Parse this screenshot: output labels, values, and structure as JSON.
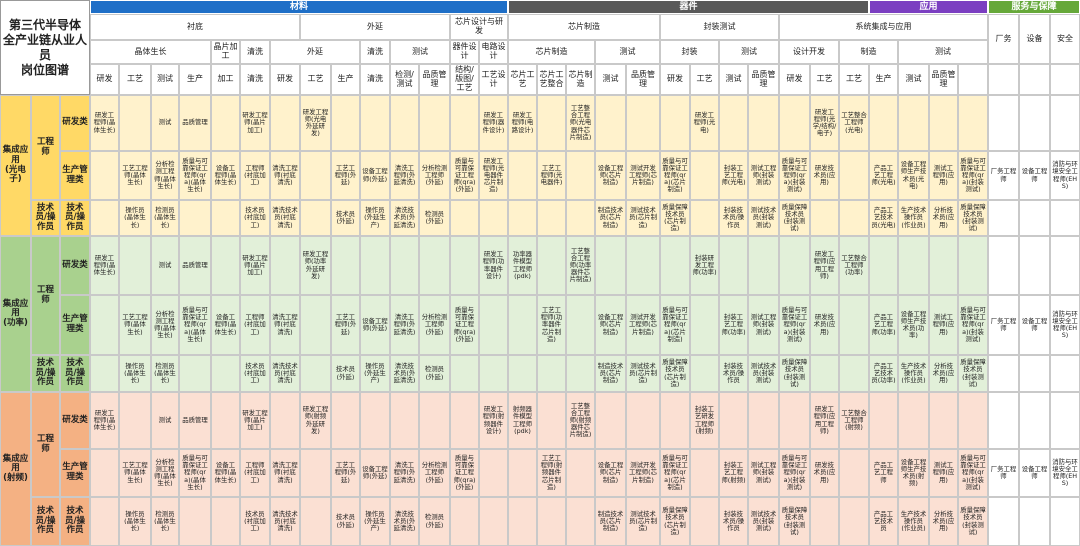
{
  "title": "第三代半导体\n全产业链从业人员\n岗位图谱",
  "colors": {
    "materials": "#1f6fc7",
    "devices": "#595959",
    "application": "#7b3fc1",
    "service": "#66a83a",
    "zone_opto": "#fff2cc",
    "zone_power": "#e2f0d9",
    "zone_rf": "#fbe0d3",
    "label_opto": "#ffd966",
    "label_power": "#a9d18e",
    "label_rf": "#f4b183"
  },
  "header": {
    "l1": [
      "材料",
      "器件",
      "应用",
      "服务与保障"
    ],
    "l2": [
      "衬底",
      "外延",
      "芯片设计与研发",
      "芯片制造",
      "封装测试",
      "系统集成与应用"
    ],
    "l3": [
      "晶体生长",
      "晶片加工",
      "清洗",
      "外延",
      "清洗",
      "测试",
      "器件设计",
      "电路设计",
      "芯片制造",
      "测试",
      "封装",
      "测试",
      "设计开发",
      "制造",
      "测试"
    ],
    "l4": [
      "研发",
      "工艺",
      "测试",
      "生产",
      "加工",
      "清洗",
      "研发",
      "工艺",
      "生产",
      "清洗",
      "检测/测试",
      "品质管理",
      "结构/版图/工艺",
      "工艺设计",
      "芯片工艺",
      "芯片工艺整合",
      "芯片制造",
      "测试",
      "品质管理",
      "研发",
      "工艺",
      "测试",
      "品质管理",
      "研发",
      "工艺",
      "工艺",
      "生产",
      "测试",
      "品质管理"
    ],
    "service": [
      "厂务",
      "设备",
      "安全"
    ]
  },
  "zones": [
    {
      "name": "集成应用\n(光电子)",
      "engineer": "工程师",
      "tech": "技术员/操作员",
      "rows": [
        {
          "label": "研发类",
          "cells": [
            "研发工程师(晶体生长)",
            "",
            "测试",
            "品质管理",
            "",
            "研发工程师(晶片加工)",
            "",
            "研发工程师(光电外延研发)",
            "",
            "",
            "",
            "",
            "",
            "研发工程师(器件设计)",
            "研发工程师(电路设计)",
            "",
            "工艺整合工程师(光电器件芯片制造)",
            "",
            "",
            "",
            "研发工程师(光电)",
            "",
            "",
            "",
            "研发工程师(光学/结构/电子)",
            "工艺整合工程师(光电)",
            "",
            "",
            "",
            "",
            "",
            "",
            ""
          ]
        },
        {
          "label": "生产管理类",
          "cells": [
            "",
            "工艺工程师(晶体生长)",
            "分析检测工程师(晶体生长)",
            "质量与可靠保证工程师(qra)(晶体生长)",
            "设备工程师(晶体生长)",
            "工程师(衬底加工)",
            "清洗工程师(衬底清洗)",
            "",
            "工艺工程师(外延)",
            "设备工程师(外延)",
            "清洗工程师(外延清洗)",
            "分析检测工程师(外延)",
            "质量与可靠保证工程师(qra)(外延)",
            "研发工程师(光电器件芯片制造)",
            "",
            "工艺工程师(光电器件)",
            "",
            "设备工程师(芯片制造)",
            "测试开发工程师(芯片制造)",
            "质量与可靠保证工程师(qra)(芯片制造)",
            "",
            "封装工艺工程师(光电)",
            "测试工程师(封装测试)",
            "质量与可靠保证工程师(qra)(封装测试)",
            "研发技术员(应用)",
            "",
            "产品工艺工程师(光电)",
            "设备工程师生产技术员(光电)",
            "测试工程师(应用)",
            "质量与可靠保证工程师(qra)(封装测试)",
            "厂务工程师",
            "设备工程师",
            "消防与环境安全工程师(EHS)"
          ]
        },
        {
          "label": "技术员/操作员",
          "cells": [
            "",
            "操作员(晶体生长)",
            "检测员(晶体生长)",
            "",
            "",
            "技术员(衬底加工)",
            "清洗技术员(衬底清洗)",
            "",
            "技术员(外延)",
            "操作员(外延生产)",
            "清洗技术员(外延清洗)",
            "检测员(外延)",
            "",
            "",
            "",
            "",
            "",
            "制造技术员(芯片制造)",
            "测试技术员(芯片制造)",
            "质量保障技术员(芯片制造)",
            "",
            "封装技术员/操作员",
            "测试技术员(封装测试)",
            "质量保障技术员(封装测试)",
            "",
            "",
            "产品工艺技术员(光电)",
            "生产技术操作员(作业员)",
            "分析技术员(应用)",
            "质量保障技术员(封装测试)",
            "",
            "",
            ""
          ]
        }
      ]
    },
    {
      "name": "集成应用\n(功率)",
      "engineer": "工程师",
      "tech": "技术员/操作员",
      "rows": [
        {
          "label": "研发类",
          "cells": [
            "研发工程师(晶体生长)",
            "",
            "测试",
            "品质管理",
            "",
            "研发工程师(晶片加工)",
            "",
            "研发工程师(功率外延研发)",
            "",
            "",
            "",
            "",
            "",
            "研发工程师(功率器件设计)",
            "功率器件模型工程师(pdk)",
            "",
            "工艺整合工程师(功率器件芯片制造)",
            "",
            "",
            "",
            "封装研发工程师(功率)",
            "",
            "",
            "",
            "研发工程师(应用工程师)",
            "工艺整合工程师(功率)",
            "",
            "",
            "",
            "",
            "",
            "",
            ""
          ]
        },
        {
          "label": "生产管理类",
          "cells": [
            "",
            "工艺工程师(晶体生长)",
            "分析检测工程师(晶体生长)",
            "质量与可靠保证工程师(qra)(晶体生长)",
            "设备工程师(晶体生长)",
            "工程师(衬底加工)",
            "清洗工程师(衬底清洗)",
            "",
            "工艺工程师(外延)",
            "设备工程师(外延)",
            "清洗工程师(外延清洗)",
            "分析检测工程师(外延)",
            "质量与可靠保证工程师(qra)(外延)",
            "",
            "",
            "工艺工程师(功率器件芯片制造)",
            "",
            "设备工程师(芯片制造)",
            "测试开发工程师(芯片制造)",
            "质量与可靠保证工程师(qra)(芯片制造)",
            "",
            "封装工艺工程师(功率)",
            "测试工程师(封装测试)",
            "质量与可靠保证工程师(qra)(封装测试)",
            "研发技术员(应用)",
            "",
            "产品工艺工程师(功率)",
            "设备工程师生产技术员(功率)",
            "测试工程师(应用)",
            "质量与可靠保证工程师(qra)(封装测试)",
            "厂务工程师",
            "设备工程师",
            "消防与环境安全工程师(EHS)"
          ]
        },
        {
          "label": "技术员/操作员",
          "cells": [
            "",
            "操作员(晶体生长)",
            "检测员(晶体生长)",
            "",
            "",
            "技术员(衬底加工)",
            "清洗技术员(衬底清洗)",
            "",
            "技术员(外延)",
            "操作员(外延生产)",
            "清洗技术员(外延清洗)",
            "检测员(外延)",
            "",
            "",
            "",
            "",
            "",
            "制造技术员(芯片制造)",
            "测试技术员(芯片制造)",
            "质量保障技术员(芯片制造)",
            "",
            "封装技术员/操作员",
            "测试技术员(封装测试)",
            "质量保障技术员(封装测试)",
            "",
            "",
            "产品工艺技术员(功率)",
            "生产技术操作员(作业员)",
            "分析技术员(应用)",
            "质量保障技术员(封装测试)",
            "",
            "",
            ""
          ]
        }
      ]
    },
    {
      "name": "集成应用\n(射频)",
      "engineer": "工程师",
      "tech": "技术员/操作员",
      "rows": [
        {
          "label": "研发类",
          "cells": [
            "研发工程师(晶体生长)",
            "",
            "测试",
            "品质管理",
            "",
            "研发工程师(晶片加工)",
            "",
            "研发工程师(射频外延研发)",
            "",
            "",
            "",
            "",
            "",
            "研发工程师(射频器件设计)",
            "射频器件模型工程师(pdk)",
            "",
            "工艺整合工程师(射频器件芯片制造)",
            "",
            "",
            "",
            "封装工艺研发工程师(射频)",
            "",
            "",
            "",
            "研发工程师(应用工程师)",
            "工艺整合工程师(射频)",
            "",
            "",
            "",
            "",
            "",
            "",
            ""
          ]
        },
        {
          "label": "生产管理类",
          "cells": [
            "",
            "工艺工程师(晶体生长)",
            "分析检测工程师(晶体生长)",
            "质量与可靠保证工程师(qra)(晶体生长)",
            "设备工程师(晶体生长)",
            "工程师(衬底加工)",
            "清洗工程师(衬底清洗)",
            "",
            "工艺工程师(外延)",
            "设备工程师(外延)",
            "清洗工程师(外延清洗)",
            "分析检测工程师(外延)",
            "质量与可靠保证工程师(qra)(外延)",
            "",
            "",
            "工艺工程师(射频器件芯片制造)",
            "",
            "设备工程师(芯片制造)",
            "测试开发工程师(芯片制造)",
            "质量与可靠保证工程师(qra)(芯片制造)",
            "",
            "封装工艺工程师(射频)",
            "测试工程师(封装测试)",
            "质量与可靠保证工程师(qra)(封装测试)",
            "研发技术员(应用)",
            "",
            "产品工艺工程师",
            "设备工程师生产技术员(射频)",
            "测试工程师(应用)",
            "质量与可靠保证工程师(qra)(封装测试)",
            "厂务工程师",
            "设备工程师",
            "消防与环境安全工程师(EHS)"
          ]
        },
        {
          "label": "技术员/操作员",
          "cells": [
            "",
            "操作员(晶体生长)",
            "检测员(晶体生长)",
            "",
            "",
            "技术员(衬底加工)",
            "清洗技术员(衬底清洗)",
            "",
            "技术员(外延)",
            "操作员(外延生产)",
            "清洗技术员(外延清洗)",
            "检测员(外延)",
            "",
            "",
            "",
            "",
            "",
            "制造技术员(芯片制造)",
            "测试技术员(芯片制造)",
            "质量保障技术员(芯片制造)",
            "",
            "封装技术员/操作员",
            "测试技术员(封装测试)",
            "质量保障技术员(封装测试)",
            "",
            "",
            "产品工艺技术员",
            "生产技术操作员(作业员)",
            "分析技术员(应用)",
            "质量保障技术员(封装测试)",
            "",
            "",
            ""
          ]
        }
      ]
    }
  ]
}
